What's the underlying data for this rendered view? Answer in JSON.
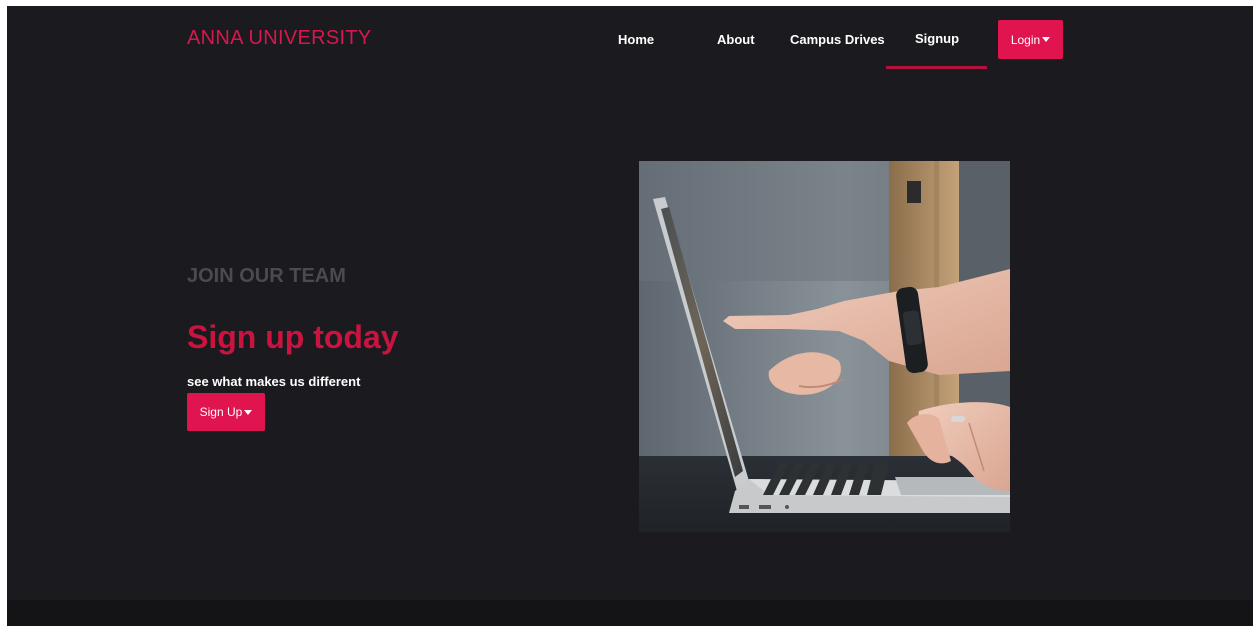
{
  "nav": {
    "brand": "ANNA UNIVERSITY",
    "links": [
      {
        "label": "Home"
      },
      {
        "label": "About"
      },
      {
        "label": "Campus Drives"
      },
      {
        "label": "Signup"
      }
    ],
    "login_label": "Login",
    "active_item": "Signup"
  },
  "hero": {
    "eyebrow": "JOIN OUR TEAM",
    "headline": "Sign up today",
    "subtext": "see what makes us different",
    "button_label": "Sign Up"
  },
  "colors": {
    "background": "#1b1a1f",
    "accent": "#e0144f",
    "headline": "#c8143f",
    "eyebrow": "#4a4a4f"
  },
  "icons": {
    "dropdown": "caret-down-icon"
  }
}
